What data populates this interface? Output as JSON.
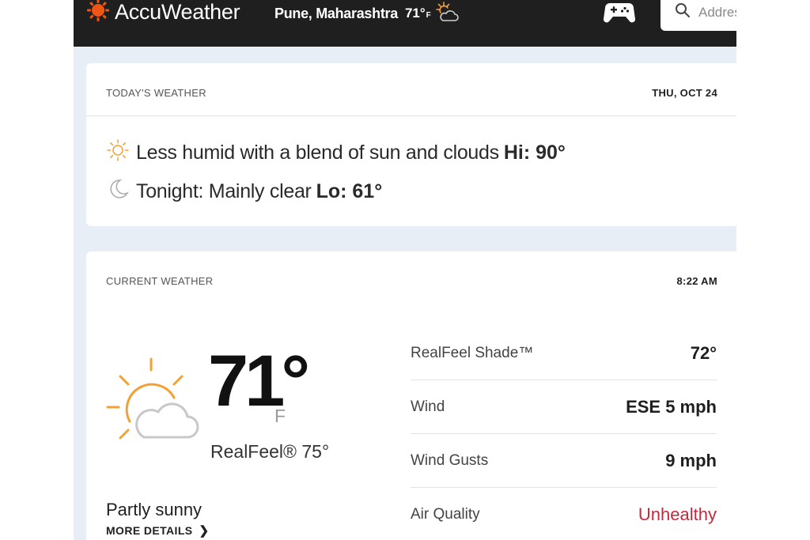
{
  "header": {
    "brand": "AccuWeather",
    "location": "Pune, Maharashtra",
    "location_temp": "71°",
    "location_unit": "F",
    "search_placeholder": "Address",
    "brand_color": "#f05514"
  },
  "today": {
    "title": "TODAY'S WEATHER",
    "date": "THU, OCT 24",
    "day_text": "Less humid with a blend of sun and clouds",
    "day_label": "Hi: 90°",
    "night_text": "Tonight: Mainly clear",
    "night_label": "Lo: 61°"
  },
  "current": {
    "title": "CURRENT WEATHER",
    "time": "8:22 AM",
    "temp": "71°",
    "unit": "F",
    "realfeel": "RealFeel® 75°",
    "phrase": "Partly sunny",
    "more_details": "MORE DETAILS",
    "details": [
      {
        "label": "RealFeel Shade™",
        "value": "72°"
      },
      {
        "label": "Wind",
        "value": "ESE 5 mph"
      },
      {
        "label": "Wind Gusts",
        "value": "9 mph"
      },
      {
        "label": "Air Quality",
        "value": "Unhealthy"
      }
    ]
  },
  "icons": {
    "brand": "sun-logo-icon",
    "location_weather": "partly-cloudy-icon",
    "games": "game-controller-icon",
    "search": "search-icon",
    "day": "sun-icon",
    "night": "moon-icon",
    "current": "partly-sunny-icon"
  },
  "colors": {
    "topbar": "#1f1f1f",
    "page_bg": "#e8eef5",
    "sun": "#f5a035",
    "unhealthy": "#c8283c"
  }
}
